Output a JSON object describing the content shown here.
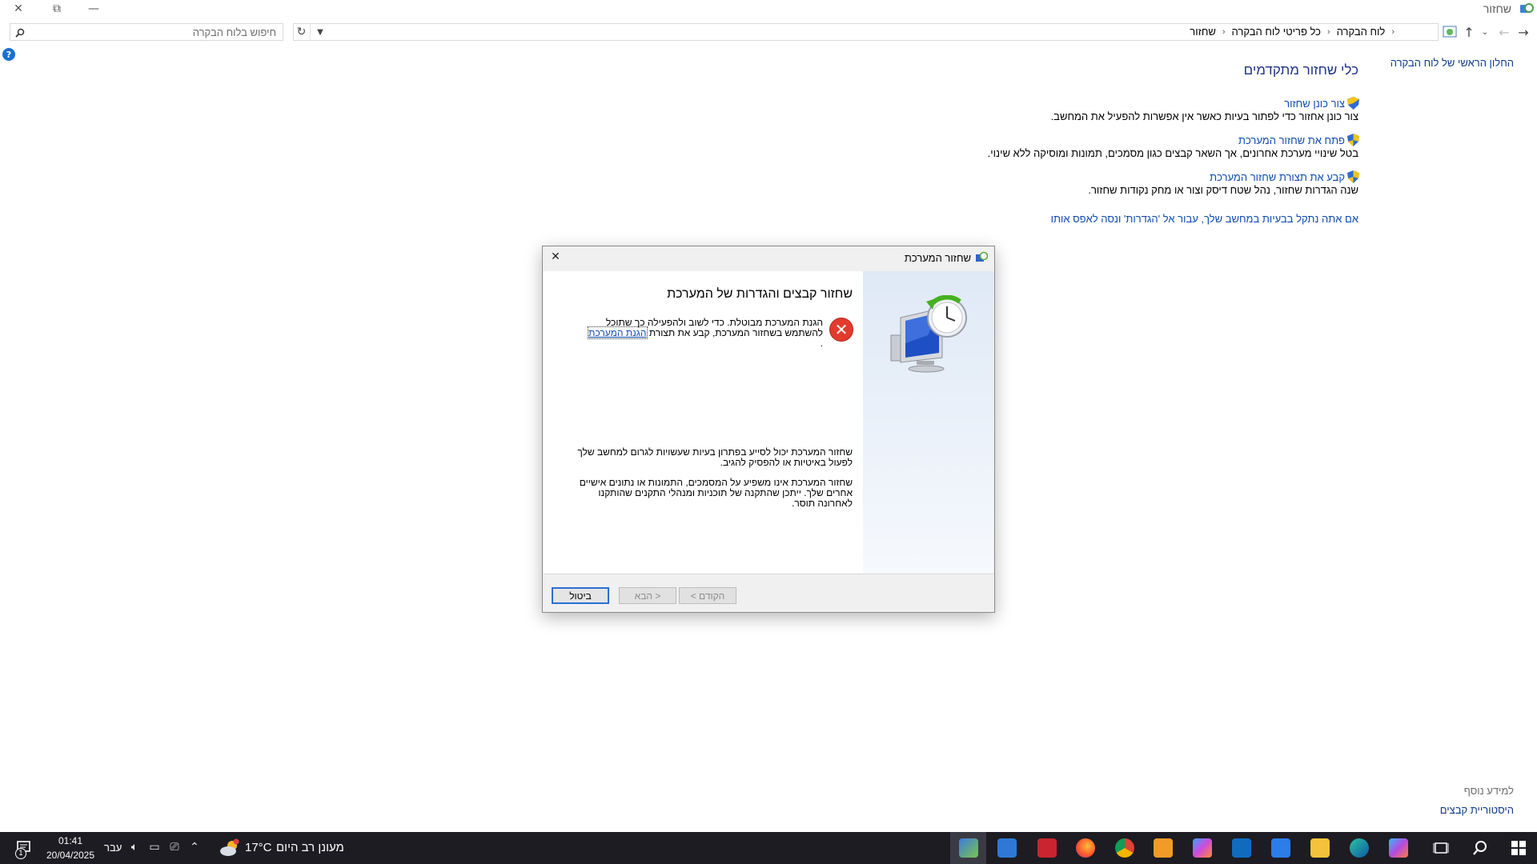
{
  "window": {
    "title": "שחזור"
  },
  "address_bar": {
    "breadcrumbs": [
      "לוח הבקרה",
      "כל פריטי לוח הבקרה",
      "שחזור"
    ]
  },
  "search": {
    "placeholder": "חיפוש בלוח הבקרה"
  },
  "left_pane": {
    "home_link": "החלון הראשי של לוח הבקרה",
    "see_also": "למידע נוסף",
    "file_history": "היסטוריית קבצים"
  },
  "main": {
    "title": "כלי שחזור מתקדמים",
    "tools": [
      {
        "link": "צור כונן שחזור",
        "desc": "צור כונן אחזור כדי לפתור בעיות כאשר אין אפשרות להפעיל את המחשב."
      },
      {
        "link": "פתח את שחזור המערכת",
        "desc": "בטל שינויי מערכת אחרונים, אך השאר קבצים כגון מסמכים, תמונות ומוסיקה ללא שינוי."
      },
      {
        "link": "קבע את תצורת שחזור המערכת",
        "desc": "שנה הגדרות שחזור, נהל שטח דיסק וצור או מחק נקודות שחזור."
      }
    ],
    "settings_link": "אם אתה נתקל בבעיות במחשב שלך, עבור אל 'הגדרות' ונסה לאפס אותו"
  },
  "dialog": {
    "title": "שחזור המערכת",
    "heading": "שחזור קבצים והגדרות של המערכת",
    "status_text": "הגנת המערכת מבוטלת. כדי לשוב ולהפעילה כך שתוכל להשתמש בשחזור המערכת, קבע את תצורת",
    "status_link": "הגנת המערכת",
    "status_end": ".",
    "para1": "שחזור המערכת יכול לסייע בפתרון בעיות שעשויות לגרום למחשב שלך לפעול באיטיות או להפסיק להגיב.",
    "para2": "שחזור המערכת אינו משפיע על המסמכים, התמונות או נתונים אישיים אחרים שלך. ייתכן שהתקנה של תוכניות ומנהלי התקנים שהותקנו לאחרונה תוסר.",
    "buttons": {
      "back": "< הקודם",
      "next": "הבא >",
      "cancel": "ביטול"
    }
  },
  "taskbar": {
    "weather_text": "מעונן רב היום",
    "temperature": "17°C",
    "language": "עבר",
    "time": "01:41",
    "date": "20/04/2025",
    "notification_count": "1"
  },
  "colors": {
    "link": "#0f4bb0",
    "title": "#1e3287",
    "taskbar": "#1c1c22",
    "error": "#e23b2e",
    "focus": "#2a6fd4"
  }
}
